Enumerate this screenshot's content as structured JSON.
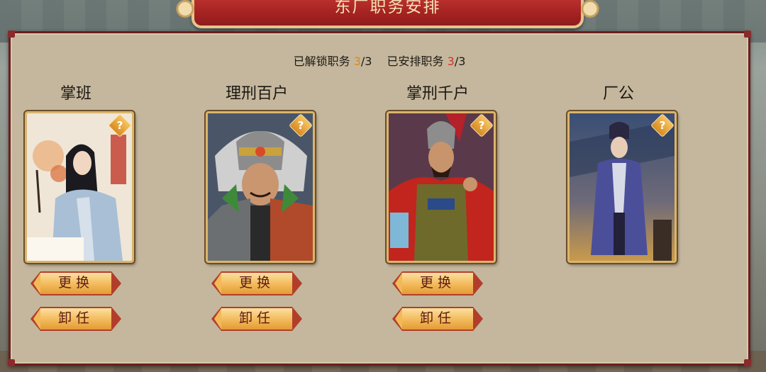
{
  "header": {
    "title": "东厂职务安排"
  },
  "summary": {
    "unlocked_label": "已解锁职务",
    "unlocked_current": "3",
    "unlocked_total": "/3",
    "assigned_label": "已安排职务",
    "assigned_current": "3",
    "assigned_total": "/3"
  },
  "positions": [
    {
      "title": "掌班",
      "help": "?",
      "change_label": "更换",
      "dismiss_label": "卸任",
      "portrait": "scholar-portrait"
    },
    {
      "title": "理刑百户",
      "help": "?",
      "change_label": "更换",
      "dismiss_label": "卸任",
      "portrait": "armored-warrior-portrait"
    },
    {
      "title": "掌刑千户",
      "help": "?",
      "change_label": "更换",
      "dismiss_label": "卸任",
      "portrait": "general-red-cape-portrait"
    },
    {
      "title": "厂公",
      "help": "?",
      "portrait": "eunuch-official-portrait"
    }
  ],
  "colors": {
    "accent_orange": "#d98a1c",
    "accent_red": "#d3322b",
    "banner_red": "#a72423"
  }
}
